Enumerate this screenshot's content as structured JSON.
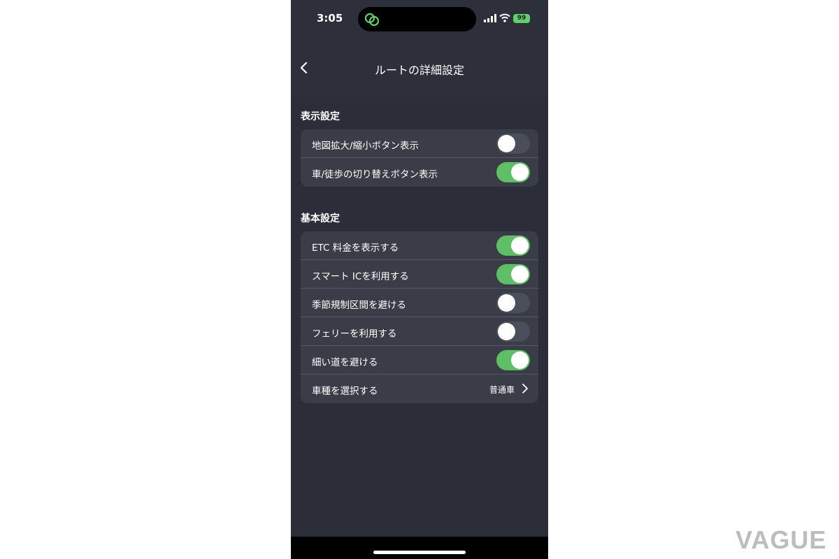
{
  "status": {
    "time": "3:05",
    "battery": "99"
  },
  "nav": {
    "title": "ルートの詳細設定"
  },
  "sections": [
    {
      "title": "表示設定",
      "rows": [
        {
          "label": "地図拡大/縮小ボタン表示",
          "on": false
        },
        {
          "label": "車/徒歩の切り替えボタン表示",
          "on": true
        }
      ]
    },
    {
      "title": "基本設定",
      "rows": [
        {
          "label": "ETC 料金を表示する",
          "on": true
        },
        {
          "label": "スマート ICを利用する",
          "on": true
        },
        {
          "label": "季節規制区間を避ける",
          "on": false
        },
        {
          "label": "フェリーを利用する",
          "on": false
        },
        {
          "label": "細い道を避ける",
          "on": true
        },
        {
          "label": "車種を選択する",
          "value": "普通車"
        }
      ]
    }
  ],
  "watermark": "VAGUE",
  "colors": {
    "toggle_on": "#5fbf66",
    "battery": "#5fd068",
    "background": "#2d2f3b"
  }
}
